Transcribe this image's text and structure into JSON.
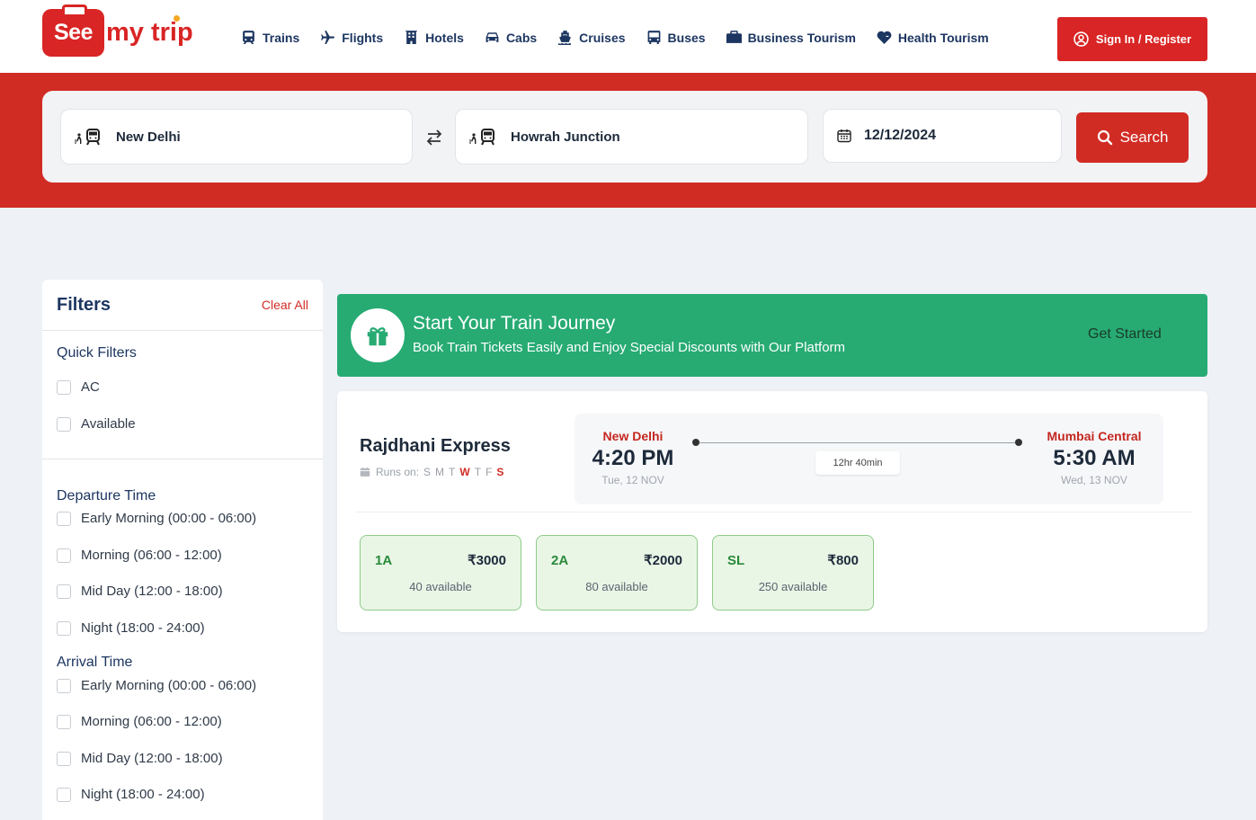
{
  "brand": {
    "logo_box": "See",
    "logo_rest": "my trip",
    "color": "#d92525"
  },
  "nav": {
    "items": [
      {
        "label": "Trains",
        "icon": "train-icon"
      },
      {
        "label": "Flights",
        "icon": "plane-icon"
      },
      {
        "label": "Hotels",
        "icon": "hotel-icon"
      },
      {
        "label": "Cabs",
        "icon": "car-icon"
      },
      {
        "label": "Cruises",
        "icon": "ship-icon"
      },
      {
        "label": "Buses",
        "icon": "bus-icon"
      },
      {
        "label": "Business Tourism",
        "icon": "briefcase-icon"
      },
      {
        "label": "Health Tourism",
        "icon": "heart-pulse-icon"
      }
    ],
    "signin_label": "Sign In / Register"
  },
  "search": {
    "from": "New Delhi",
    "to": "Howrah Junction",
    "date": "12/12/2024",
    "button_label": "Search"
  },
  "filters": {
    "title": "Filters",
    "clear_label": "Clear All",
    "quick_title": "Quick Filters",
    "quick": [
      "AC",
      "Available"
    ],
    "departure_title": "Departure Time",
    "departure": [
      "Early Morning (00:00 - 06:00)",
      "Morning (06:00 - 12:00)",
      "Mid Day (12:00 - 18:00)",
      "Night (18:00 - 24:00)"
    ],
    "arrival_title": "Arrival Time",
    "arrival": [
      "Early Morning (00:00 - 06:00)",
      "Morning (06:00 - 12:00)",
      "Mid Day (12:00 - 18:00)",
      "Night (18:00 - 24:00)"
    ]
  },
  "promo": {
    "title": "Start Your Train Journey",
    "subtitle": "Book Train Tickets Easily and Enjoy Special Discounts with Our Platform",
    "cta": "Get Started",
    "color": "#27ab73"
  },
  "train": {
    "name": "Rajdhani Express",
    "runs_label": "Runs on:",
    "days": [
      {
        "d": "S",
        "on": false
      },
      {
        "d": "M",
        "on": false
      },
      {
        "d": "T",
        "on": false
      },
      {
        "d": "W",
        "on": true
      },
      {
        "d": "T",
        "on": false
      },
      {
        "d": "F",
        "on": false
      },
      {
        "d": "S",
        "on": true
      }
    ],
    "from_station": "New Delhi",
    "from_time": "4:20 PM",
    "from_date": "Tue, 12 NOV",
    "to_station": "Mumbai Central",
    "to_time": "5:30 AM",
    "to_date": "Wed, 13 NOV",
    "duration": "12hr 40min",
    "classes": [
      {
        "code": "1A",
        "price": "₹3000",
        "avail": "40 available"
      },
      {
        "code": "2A",
        "price": "₹2000",
        "avail": "80 available"
      },
      {
        "code": "SL",
        "price": "₹800",
        "avail": "250 available"
      }
    ]
  }
}
